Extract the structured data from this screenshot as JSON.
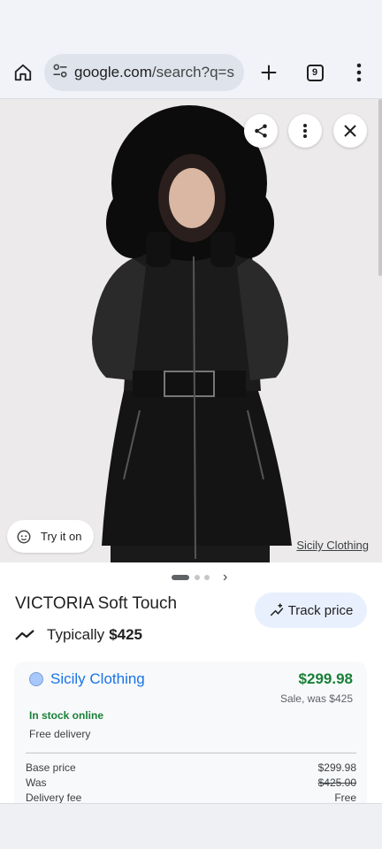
{
  "browser": {
    "url_host": "google.com",
    "url_path": "/search?q=s",
    "tab_count": "9"
  },
  "image_viewer": {
    "try_on_label": "Try it on",
    "source_label": "Sicily Clothing"
  },
  "product": {
    "title": "VICTORIA Soft Touch",
    "typically_label": "Typically",
    "typical_price": "$425",
    "track_price_label": "Track price"
  },
  "offer": {
    "merchant": "Sicily Clothing",
    "price": "$299.98",
    "sale_note": "Sale, was $425",
    "stock": "In stock online",
    "delivery": "Free delivery",
    "breakdown": [
      {
        "label": "Base price",
        "value": "$299.98"
      },
      {
        "label": "Was",
        "value": "$425.00"
      },
      {
        "label": "Delivery fee",
        "value": "Free"
      }
    ]
  },
  "colors": {
    "accent_blue": "#1a73e8",
    "price_green": "#188038",
    "track_bg": "#e8f0fe"
  }
}
